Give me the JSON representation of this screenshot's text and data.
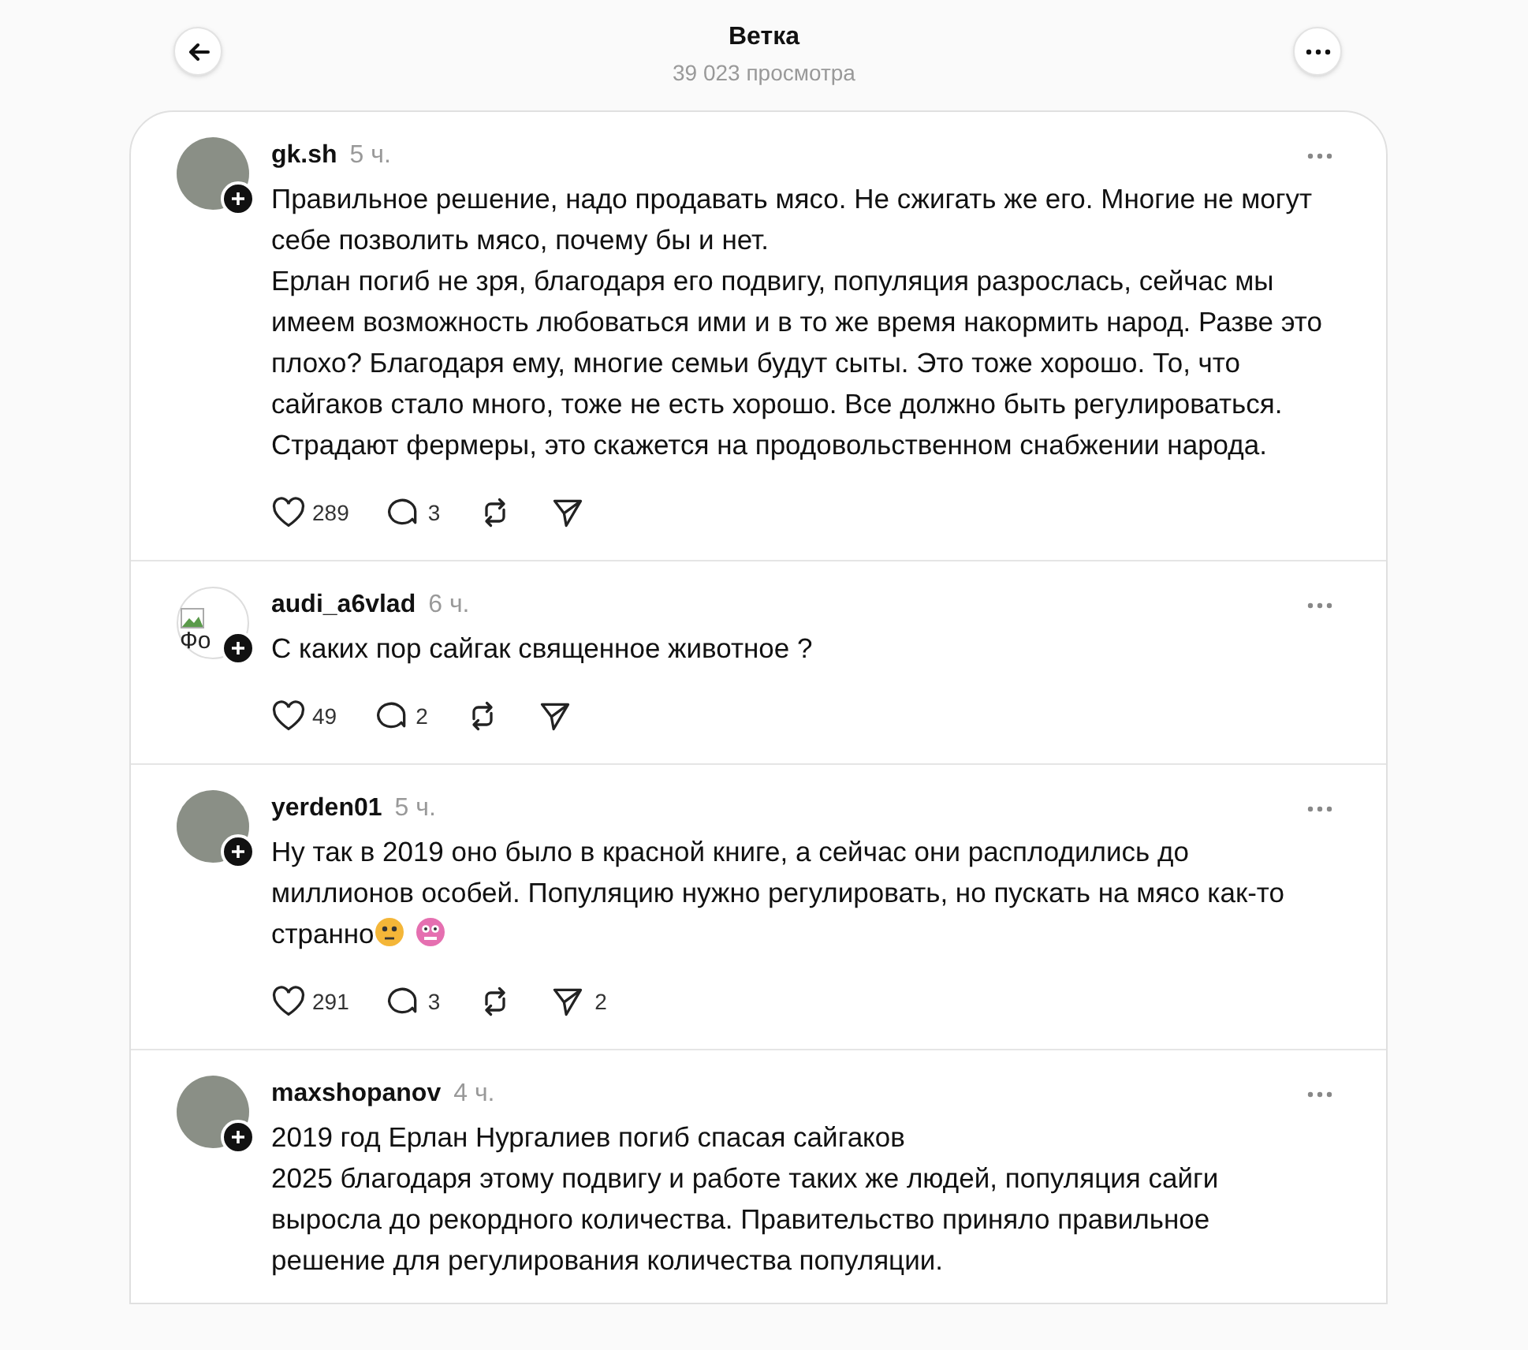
{
  "header": {
    "title": "Ветка",
    "subtitle": "39 023 просмотра"
  },
  "posts": [
    {
      "user": "gk.sh",
      "time": "5 ч.",
      "avatar": {
        "kind": "photo"
      },
      "paragraphs": [
        "Правильное решение, надо продавать мясо. Не сжигать же его. Многие не могут себе позволить мясо, почему бы и нет.",
        "Ерлан погиб не зря, благодаря его подвигу, популяция разрослась, сейчас мы имеем возможность любоваться ими и в то же время накормить народ. Разве это плохо? Благодаря ему, многие семьи будут сыты. Это тоже хорошо. То, что сайгаков стало много, тоже не есть хорошо. Все должно быть регулироваться. Страдают фермеры, это скажется на продовольственном снабжении народа."
      ],
      "ends_with_emojis": false,
      "actions": {
        "likes": "289",
        "replies": "3"
      }
    },
    {
      "user": "audi_a6vlad",
      "time": "6 ч.",
      "avatar": {
        "kind": "broken",
        "alt": "Фо"
      },
      "paragraphs": [
        "С каких пор сайгак священное животное ?"
      ],
      "ends_with_emojis": false,
      "actions": {
        "likes": "49",
        "replies": "2"
      }
    },
    {
      "user": "yerden01",
      "time": "5 ч.",
      "avatar": {
        "kind": "photo"
      },
      "paragraphs": [
        "Ну так в 2019 оно было в красной книге, а сейчас они расплодились до миллионов особей. Популяцию нужно регулировать, но пускать на мясо как-то странно"
      ],
      "ends_with_emojis": true,
      "actions": {
        "likes": "291",
        "replies": "3",
        "shares": "2"
      }
    },
    {
      "user": "maxshopanov",
      "time": "4 ч.",
      "avatar": {
        "kind": "photo"
      },
      "paragraphs": [
        "2019 год Ерлан Нургалиев погиб спасая сайгаков",
        "2025 благодаря этому подвигу и работе таких же людей, популяция сайги выросла до рекордного количества. Правительство приняло правильное решение для регулирования количества популяции."
      ],
      "ends_with_emojis": false
    }
  ]
}
